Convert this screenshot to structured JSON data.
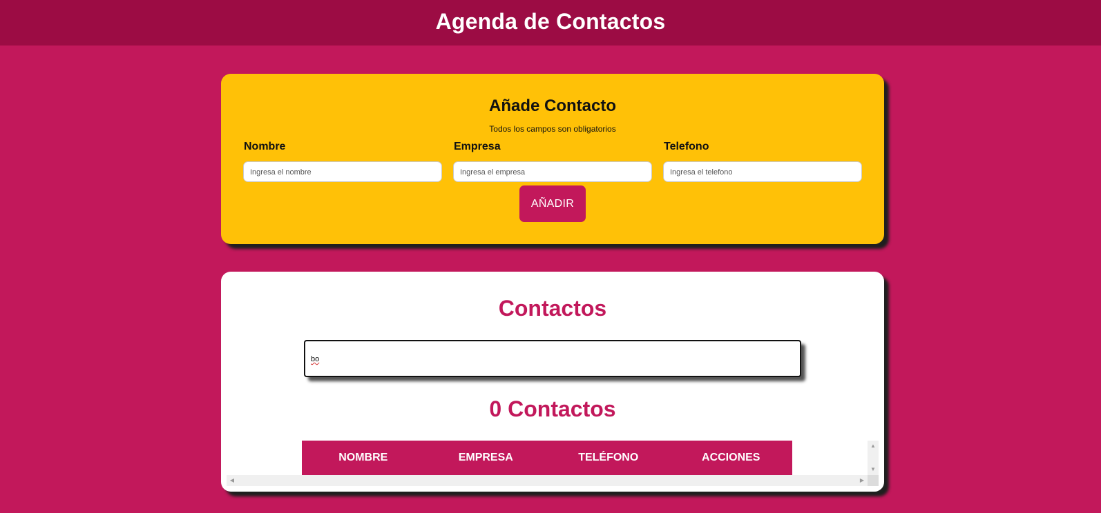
{
  "header": {
    "title": "Agenda de Contactos"
  },
  "add_form": {
    "title": "Añade Contacto",
    "subtitle": "Todos los campos son obligatorios",
    "fields": [
      {
        "label": "Nombre",
        "placeholder": "Ingresa el nombre"
      },
      {
        "label": "Empresa",
        "placeholder": "Ingresa el empresa"
      },
      {
        "label": "Telefono",
        "placeholder": "Ingresa el telefono"
      }
    ],
    "button_label": "AÑADIR"
  },
  "contacts": {
    "title": "Contactos",
    "search_value": "bo",
    "count_text": "0 Contactos",
    "columns": [
      "NOMBRE",
      "EMPRESA",
      "TELÉFONO",
      "ACCIONES"
    ]
  },
  "colors": {
    "background": "#c2185b",
    "header": "#9c0c44",
    "form_card": "#ffc107",
    "accent": "#c2185b"
  }
}
